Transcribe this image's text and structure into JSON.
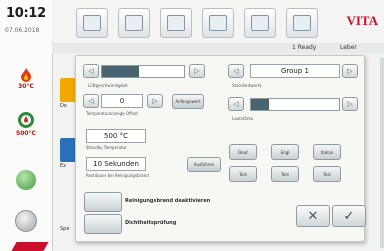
{
  "header": {
    "time": "10:12",
    "date": "07.06.2018",
    "brand": "VITA"
  },
  "status": {
    "ready": "1 Ready",
    "user": "Leber"
  },
  "sidebar": {
    "temp1": "30°C",
    "temp2": "500°C"
  },
  "tiles": {
    "t1": "De",
    "t2": "Ex",
    "t3": "Spe"
  },
  "panel": {
    "left_bar_label": "Lüftgeschwindigkeit",
    "stepper_value": "0",
    "stepper_label": "Temperaturanzeige Offset",
    "stepper_btn": "Anfangswert",
    "standby_value": "500 °C",
    "standby_label": "Standby Temperatur",
    "seconds_value": "10 Sekunden",
    "seconds_label": "Restdauer bei Reinigungsbrand",
    "seconds_btn": "Ausführen",
    "group_value": "Group 1",
    "group_label": "Standardwerte",
    "volume_label": "Lautstärke",
    "lang_buttons": [
      "Deut",
      "Engl",
      "Italian",
      "Test",
      "Test",
      "Test"
    ],
    "btn1": "Reinigungsbrand deaktivieren",
    "btn2": "Dichtheitsprüfung",
    "bar_fill": 0.45,
    "vol_fill": 0.2
  }
}
